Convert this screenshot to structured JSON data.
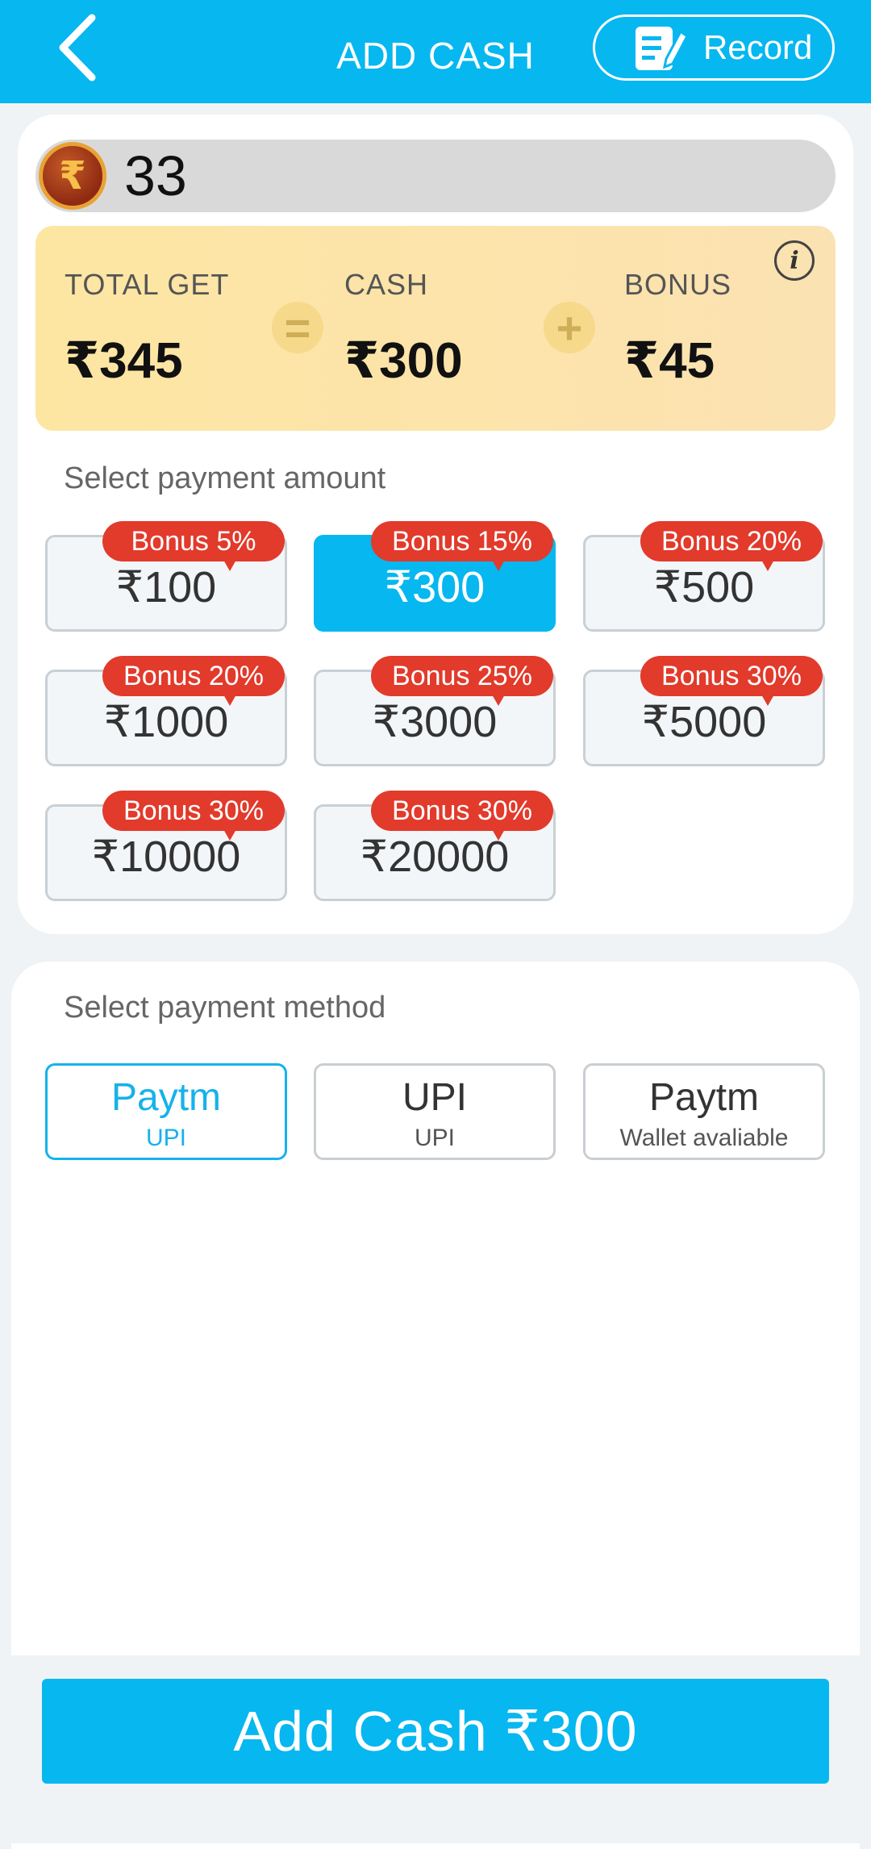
{
  "header": {
    "title": "ADD CASH",
    "record_label": "Record"
  },
  "balance": {
    "value": "33",
    "coin_symbol": "₹"
  },
  "summary": {
    "total_label": "TOTAL GET",
    "total_value": "₹345",
    "equals_symbol": "=",
    "cash_label": "CASH",
    "cash_value": "₹300",
    "plus_symbol": "+",
    "bonus_label": "BONUS",
    "bonus_value": "₹45",
    "info_glyph": "i"
  },
  "amounts": {
    "title": "Select payment amount",
    "items": [
      {
        "bonus": "Bonus 5%",
        "value": "₹100",
        "selected": false
      },
      {
        "bonus": "Bonus 15%",
        "value": "₹300",
        "selected": true
      },
      {
        "bonus": "Bonus 20%",
        "value": "₹500",
        "selected": false
      },
      {
        "bonus": "Bonus 20%",
        "value": "₹1000",
        "selected": false
      },
      {
        "bonus": "Bonus 25%",
        "value": "₹3000",
        "selected": false
      },
      {
        "bonus": "Bonus 30%",
        "value": "₹5000",
        "selected": false
      },
      {
        "bonus": "Bonus 30%",
        "value": "₹10000",
        "selected": false
      },
      {
        "bonus": "Bonus 30%",
        "value": "₹20000",
        "selected": false
      }
    ]
  },
  "methods": {
    "title": "Select payment method",
    "items": [
      {
        "name": "Paytm",
        "sub": "UPI",
        "selected": true
      },
      {
        "name": "UPI",
        "sub": "UPI",
        "selected": false
      },
      {
        "name": "Paytm",
        "sub": "Wallet avaliable",
        "selected": false
      }
    ]
  },
  "footer": {
    "add_cash_label": "Add Cash ₹300"
  },
  "icons": {
    "back": "chevron-left-icon",
    "record": "edit-document-icon",
    "coin": "rupee-coin-icon",
    "info": "info-icon"
  },
  "colors": {
    "primary": "#06b7f0",
    "badge": "#e23a2b",
    "summary_bg": "#fde6a2",
    "page_bg": "#eff3f5"
  }
}
